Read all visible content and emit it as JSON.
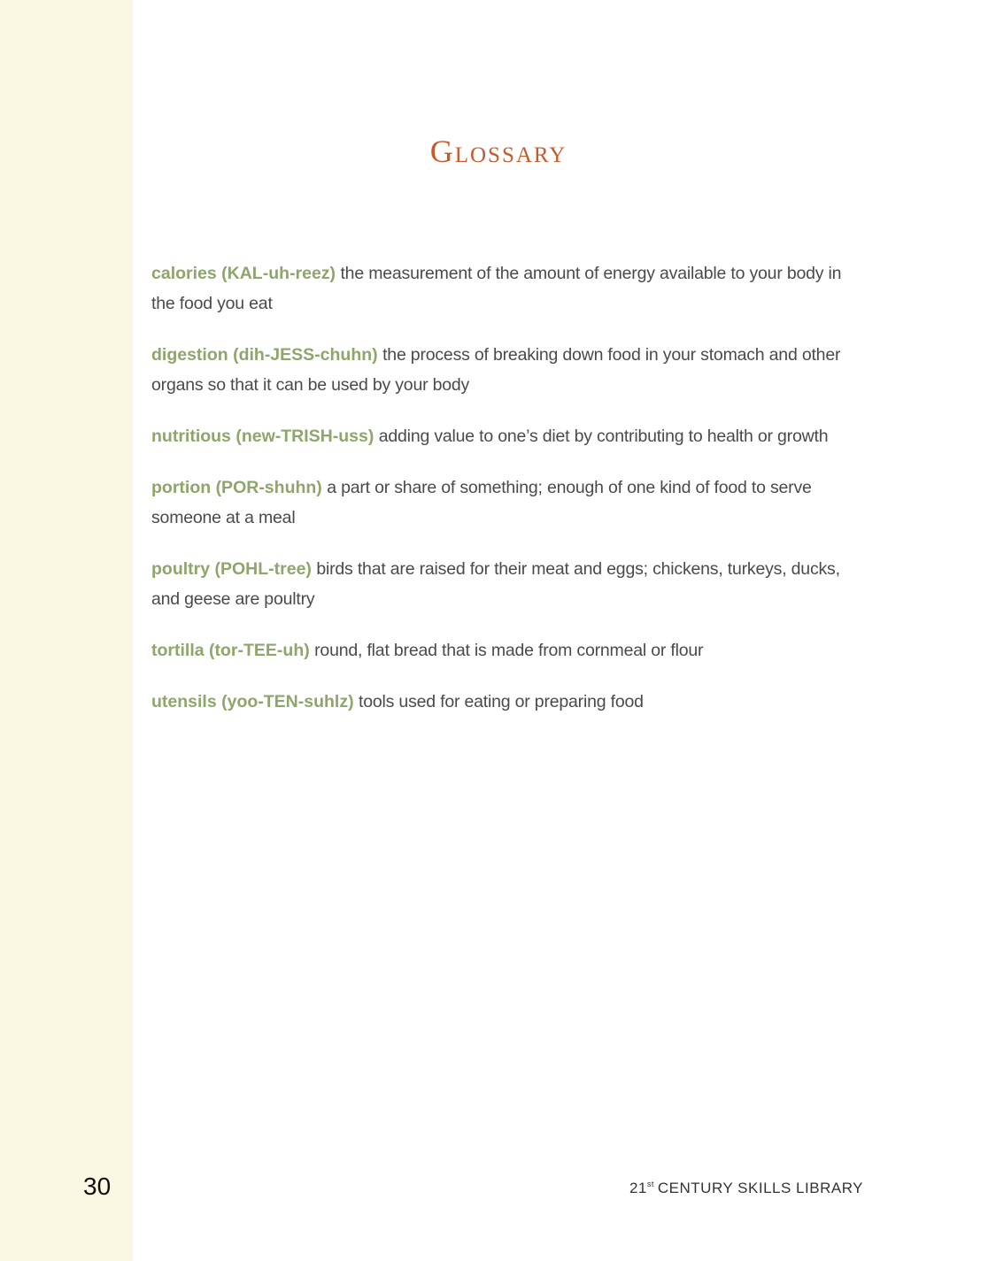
{
  "title": "Glossary",
  "entries": [
    {
      "term": "calories (KAL-uh-reez)",
      "definition": "the measurement of the amount of energy available to your body in the food you eat"
    },
    {
      "term": "digestion (dih-JESS-chuhn)",
      "definition": "the process of breaking down food in your stomach and other organs so that it can be used by your body"
    },
    {
      "term": "nutritious (new-TRISH-uss)",
      "definition": "adding value to one’s diet by contributing to health or growth"
    },
    {
      "term": "portion (POR-shuhn)",
      "definition": "a part or share of something; enough of one kind of food to serve someone at a meal"
    },
    {
      "term": "poultry (POHL-tree)",
      "definition": "birds that are raised for their meat and eggs; chickens, turkeys, ducks, and geese are poultry"
    },
    {
      "term": "tortilla (tor-TEE-uh)",
      "definition": "round, flat bread that is made from cornmeal or flour"
    },
    {
      "term": "utensils (yoo-TEN-suhlz)",
      "definition": "tools used for eating or preparing food"
    }
  ],
  "footer": {
    "page_number": "30",
    "series_prefix": "21",
    "series_superscript": "st",
    "series_rest": "CENTURY SKILLS LIBRARY"
  },
  "colors": {
    "title": "#c85a2a",
    "term": "#8ea56b",
    "side_strip": "#faf7e3"
  }
}
